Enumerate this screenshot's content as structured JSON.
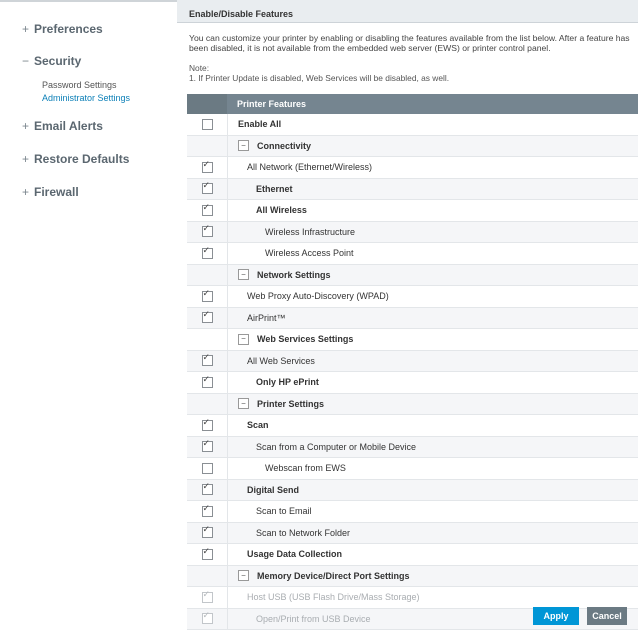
{
  "sidebar": {
    "items": [
      {
        "label": "Preferences",
        "symbol": "+"
      },
      {
        "label": "Security",
        "symbol": "−",
        "children": [
          {
            "label": "Password Settings"
          },
          {
            "label": "Administrator Settings"
          }
        ]
      },
      {
        "label": "Email Alerts",
        "symbol": "+"
      },
      {
        "label": "Restore Defaults",
        "symbol": "+"
      },
      {
        "label": "Firewall",
        "symbol": "+"
      }
    ]
  },
  "main": {
    "section_title": "Enable/Disable Features",
    "intro": "You can customize your printer by enabling or disabling the features available from the list below.  After a feature has been disabled, it is not available from the embedded web server (EWS) or printer control panel.",
    "note_label": "Note:",
    "note_text": "1.  If Printer Update is disabled, Web Services will be disabled, as well.",
    "table_header": "Printer Features",
    "rows": [
      {
        "label": "Enable All",
        "checkbox": "unchecked"
      },
      {
        "label": "Connectivity",
        "group": true
      },
      {
        "label": "All Network (Ethernet/Wireless)",
        "checkbox": "checked"
      },
      {
        "label": "Ethernet",
        "checkbox": "checked"
      },
      {
        "label": "All Wireless",
        "checkbox": "checked"
      },
      {
        "label": "Wireless Infrastructure",
        "checkbox": "checked"
      },
      {
        "label": "Wireless Access Point",
        "checkbox": "checked"
      },
      {
        "label": "Network Settings",
        "group": true
      },
      {
        "label": "Web Proxy Auto-Discovery (WPAD)",
        "checkbox": "checked"
      },
      {
        "label": "AirPrint™",
        "checkbox": "checked"
      },
      {
        "label": "Web Services Settings",
        "group": true
      },
      {
        "label": "All Web Services",
        "checkbox": "checked"
      },
      {
        "label": "Only HP ePrint",
        "checkbox": "checked"
      },
      {
        "label": "Printer Settings",
        "group": true
      },
      {
        "label": "Scan",
        "checkbox": "checked"
      },
      {
        "label": "Scan from a Computer or Mobile Device",
        "checkbox": "checked"
      },
      {
        "label": "Webscan from EWS",
        "checkbox": "unchecked"
      },
      {
        "label": "Digital Send",
        "checkbox": "checked"
      },
      {
        "label": "Scan to Email",
        "checkbox": "checked"
      },
      {
        "label": "Scan to Network Folder",
        "checkbox": "checked"
      },
      {
        "label": "Usage Data Collection",
        "checkbox": "checked"
      },
      {
        "label": "Memory Device/Direct Port Settings",
        "group": true
      },
      {
        "label": "Host USB (USB Flash Drive/Mass Storage)",
        "checkbox": "checked",
        "disabled": true
      },
      {
        "label": "Open/Print from USB Device",
        "checkbox": "checked",
        "disabled": true
      }
    ],
    "buttons": {
      "apply": "Apply",
      "cancel": "Cancel"
    }
  },
  "colors": {
    "accent": "#0096d6",
    "header": "#6b7a83",
    "active_link": "#0b7fb7"
  }
}
